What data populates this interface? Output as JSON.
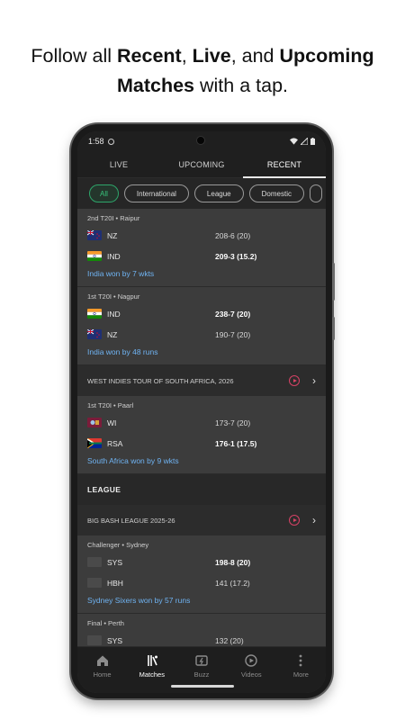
{
  "caption": {
    "line1_a": "Follow all ",
    "line1_b": "Recent",
    "line1_c": ", ",
    "line1_d": "Live",
    "line1_e": ", and ",
    "line1_f": "Upcoming",
    "line2_a": "Matches",
    "line2_b": " with a tap."
  },
  "status_bar": {
    "time": "1:58"
  },
  "tabs": [
    {
      "label": "LIVE",
      "active": false
    },
    {
      "label": "UPCOMING",
      "active": false
    },
    {
      "label": "RECENT",
      "active": true
    }
  ],
  "filters": [
    {
      "label": "All",
      "active": true
    },
    {
      "label": "International",
      "active": false
    },
    {
      "label": "League",
      "active": false
    },
    {
      "label": "Domestic",
      "active": false
    }
  ],
  "matches_top": [
    {
      "meta": "2nd T20I • Raipur",
      "teams": [
        {
          "name": "NZ",
          "score": "208-6 (20)",
          "flag": "nz",
          "winner": false
        },
        {
          "name": "IND",
          "score": "209-3 (15.2)",
          "flag": "ind",
          "winner": true
        }
      ],
      "result": "India won by 7 wkts"
    },
    {
      "meta": "1st T20I • Nagpur",
      "teams": [
        {
          "name": "IND",
          "score": "238-7 (20)",
          "flag": "ind",
          "winner": true
        },
        {
          "name": "NZ",
          "score": "190-7 (20)",
          "flag": "nz",
          "winner": false
        }
      ],
      "result": "India won by 48 runs"
    }
  ],
  "series_1": {
    "title": "WEST INDIES TOUR OF SOUTH AFRICA, 2026"
  },
  "match_3": {
    "meta": "1st T20I • Paarl",
    "teams": [
      {
        "name": "WI",
        "score": "173-7 (20)",
        "flag": "wi",
        "winner": false
      },
      {
        "name": "RSA",
        "score": "176-1 (17.5)",
        "flag": "rsa",
        "winner": true
      }
    ],
    "result": "South Africa won by 9 wkts"
  },
  "section_league": {
    "label": "LEAGUE"
  },
  "series_2": {
    "title": "BIG BASH LEAGUE 2025-26"
  },
  "match_4": {
    "meta": "Challenger • Sydney",
    "teams": [
      {
        "name": "SYS",
        "score": "198-8 (20)",
        "flag": "blank",
        "winner": true
      },
      {
        "name": "HBH",
        "score": "141 (17.2)",
        "flag": "blank",
        "winner": false
      }
    ],
    "result": "Sydney Sixers won by 57 runs"
  },
  "match_5": {
    "meta": "Final • Perth",
    "teams": [
      {
        "name": "SYS",
        "score": "132 (20)",
        "flag": "blank",
        "winner": false
      }
    ]
  },
  "bottom_nav": [
    {
      "label": "Home",
      "icon": "home-icon",
      "active": false
    },
    {
      "label": "Matches",
      "icon": "matches-icon",
      "active": true
    },
    {
      "label": "Buzz",
      "icon": "buzz-icon",
      "active": false
    },
    {
      "label": "Videos",
      "icon": "videos-icon",
      "active": false
    },
    {
      "label": "More",
      "icon": "more-icon",
      "active": false
    }
  ],
  "colors": {
    "accent_green": "#38c27b",
    "result_blue": "#6fb3f2",
    "live_red": "#d64265"
  }
}
